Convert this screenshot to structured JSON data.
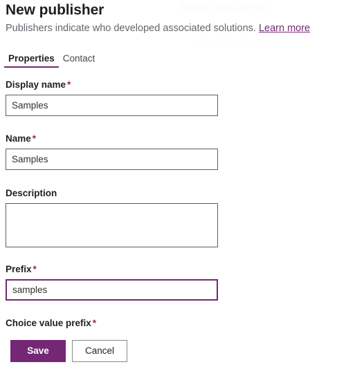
{
  "header": {
    "title": "New publisher",
    "subtitle_text": "Publishers indicate who developed associated solutions.",
    "learn_more_label": "Learn more"
  },
  "background_ghost": {
    "title": "New solution",
    "subtitle": "Solutions are used to",
    "footer": "Cancel"
  },
  "tabs": [
    {
      "label": "Properties",
      "active": true
    },
    {
      "label": "Contact",
      "active": false
    }
  ],
  "form": {
    "display_name": {
      "label": "Display name",
      "required_marker": "*",
      "value": "Samples",
      "placeholder": ""
    },
    "name": {
      "label": "Name",
      "required_marker": "*",
      "value": "Samples",
      "placeholder": ""
    },
    "description": {
      "label": "Description",
      "required_marker": "",
      "value": "",
      "placeholder": ""
    },
    "prefix": {
      "label": "Prefix",
      "required_marker": "*",
      "value": "samples",
      "placeholder": "",
      "focused": true
    },
    "choice_value_prefix": {
      "label": "Choice value prefix",
      "required_marker": "*"
    }
  },
  "footer": {
    "save_label": "Save",
    "cancel_label": "Cancel"
  },
  "colors": {
    "accent": "#742774",
    "required": "#a4262c",
    "border": "#605e5c",
    "text": "#201f1e",
    "subtle_text": "#61656b"
  }
}
